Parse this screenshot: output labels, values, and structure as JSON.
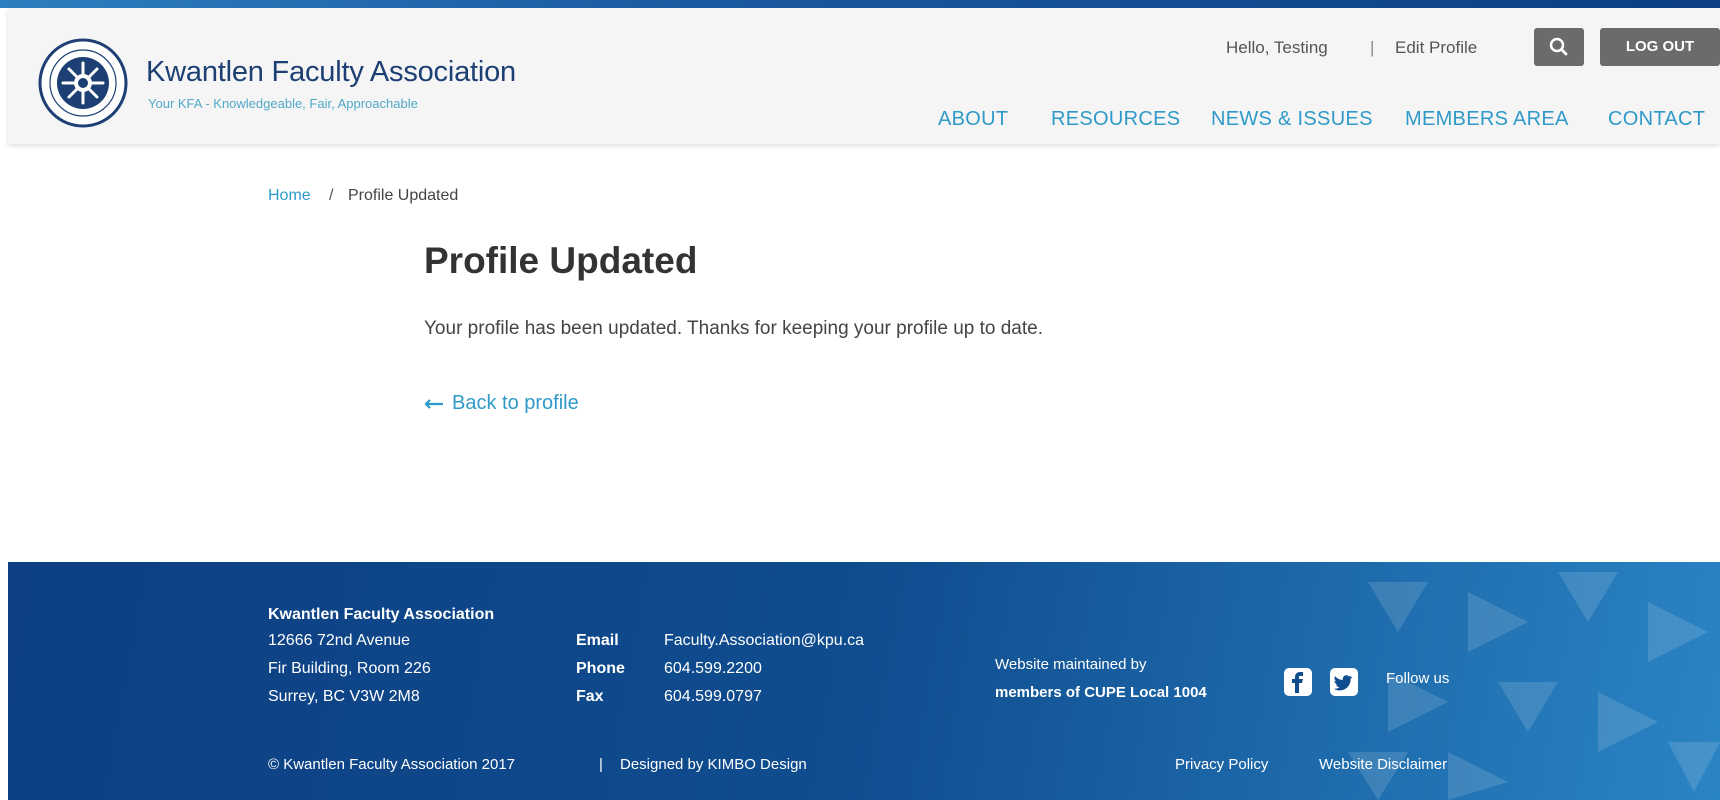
{
  "header": {
    "org_name": "Kwantlen Faculty Association",
    "tagline": "Your KFA - Knowledgeable, Fair, Approachable",
    "greeting": "Hello, Testing",
    "separator": "|",
    "edit_profile": "Edit Profile",
    "logout": "LOG OUT",
    "search_icon": "search-icon"
  },
  "nav": {
    "items": [
      {
        "label": "ABOUT"
      },
      {
        "label": "RESOURCES"
      },
      {
        "label": "NEWS & ISSUES"
      },
      {
        "label": "MEMBERS AREA"
      },
      {
        "label": "CONTACT"
      }
    ]
  },
  "breadcrumb": {
    "home": "Home",
    "separator": "/",
    "current": "Profile Updated"
  },
  "main": {
    "title": "Profile Updated",
    "message": "Your profile has been updated. Thanks for keeping your profile up to date.",
    "back_link": "Back to profile"
  },
  "footer": {
    "org_name": "Kwantlen Faculty Association",
    "address_lines": [
      "12666 72nd Avenue",
      "Fir Building, Room 226",
      "Surrey, BC V3W 2M8"
    ],
    "contacts": [
      {
        "label": "Email",
        "value": "Faculty.Association@kpu.ca"
      },
      {
        "label": "Phone",
        "value": "604.599.2200"
      },
      {
        "label": "Fax",
        "value": "604.599.0797"
      }
    ],
    "maintained_by": "Website maintained by",
    "maintained_org": "members of CUPE Local 1004",
    "follow_us": "Follow us",
    "copyright": "© Kwantlen Faculty Association 2017",
    "copyright_sep": "|",
    "designed_by": "Designed by KIMBO Design",
    "privacy": "Privacy Policy",
    "disclaimer": "Website Disclaimer",
    "social_icons": [
      "facebook-icon",
      "twitter-icon"
    ]
  },
  "colors": {
    "brand_navy": "#1d3f73",
    "link_blue": "#2f9ac9",
    "footer_blue": "#0d3f82",
    "button_gray": "#6b6b6b"
  }
}
